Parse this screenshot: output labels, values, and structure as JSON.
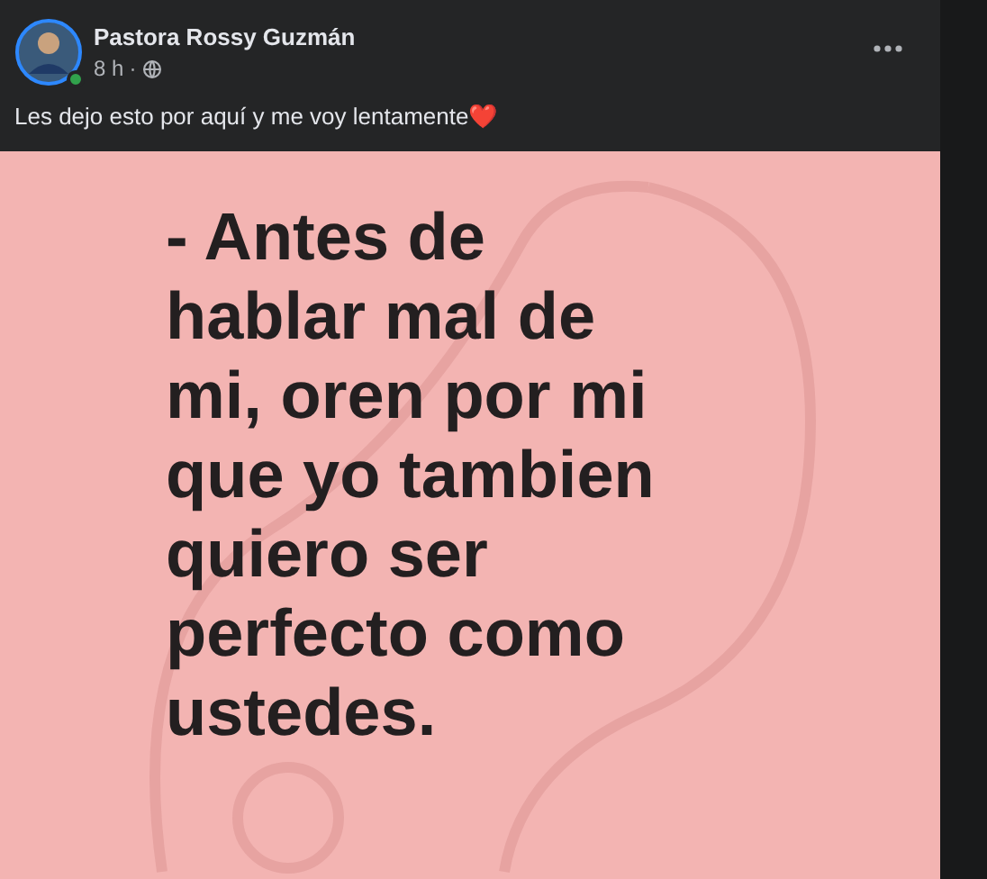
{
  "post": {
    "author": "Pastora Rossy Guzmán",
    "author_online": true,
    "time": "8 h",
    "separator": "·",
    "text": "Les dejo esto por aquí y me voy lentamente❤️",
    "image": {
      "lines": [
        "- Antes de",
        "hablar mal de",
        "mi, oren por mi",
        "que yo tambien",
        "quiero ser",
        "perfecto como",
        "ustedes."
      ]
    }
  }
}
